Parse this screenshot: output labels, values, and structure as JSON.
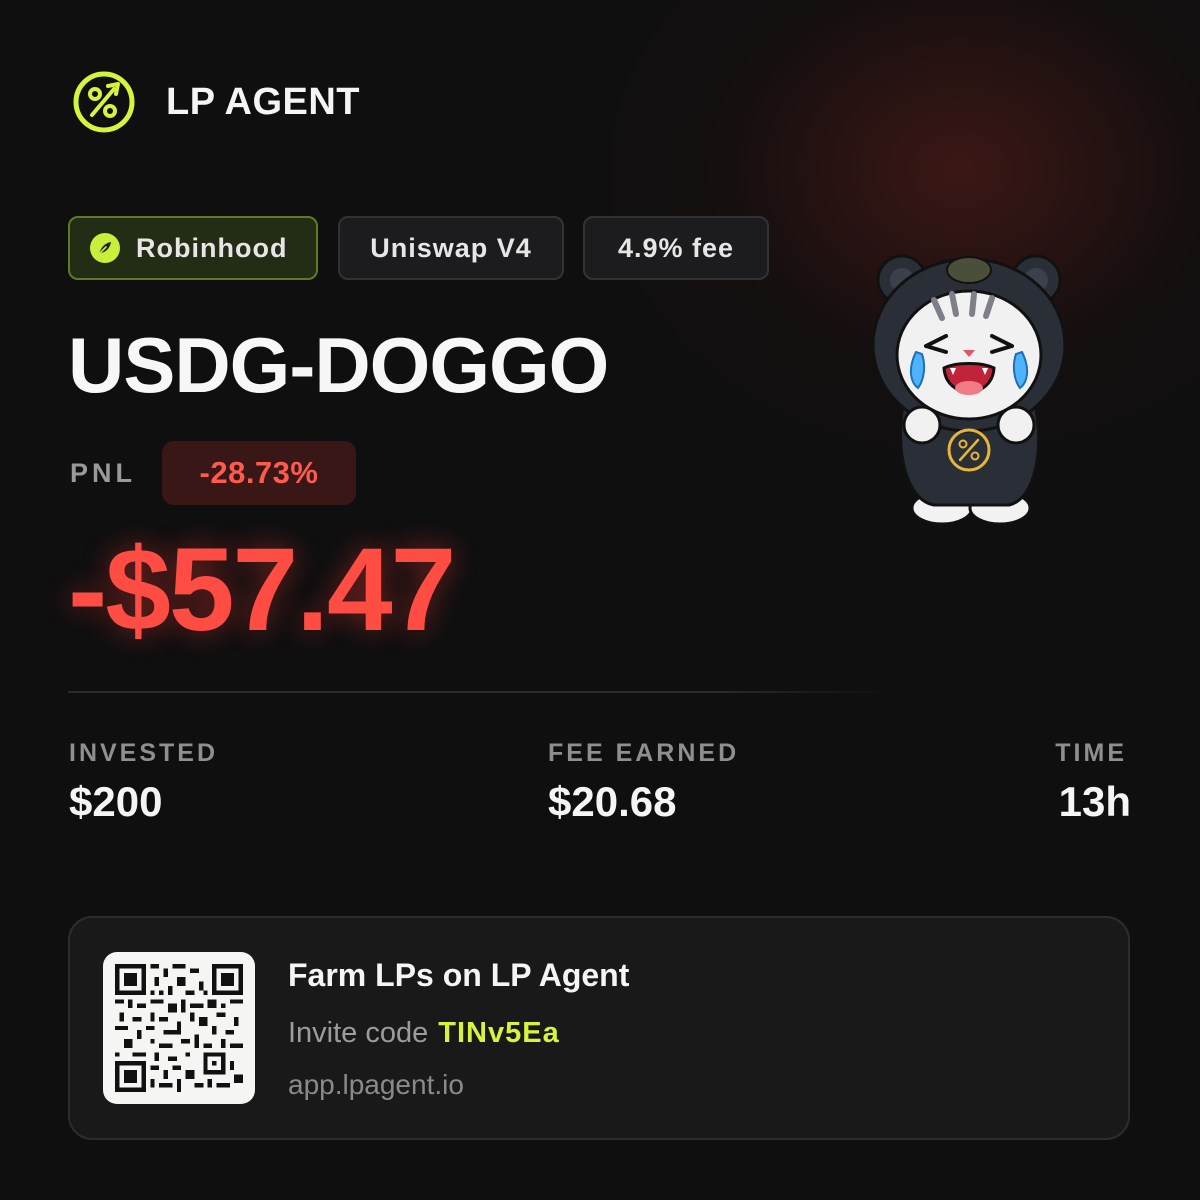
{
  "brand": {
    "name": "LP AGENT",
    "logo_icon": "percent-arrow-icon",
    "accent_color": "#d4f53c"
  },
  "tags": {
    "chain": "Robinhood",
    "chain_icon": "feather-icon",
    "dex": "Uniswap V4",
    "fee_tier": "4.9% fee"
  },
  "pair": "USDG-DOGGO",
  "pnl": {
    "label": "PNL",
    "percent": "-28.73%",
    "amount": "-$57.47",
    "color": "#ff4d43"
  },
  "stats": {
    "invested": {
      "label": "INVESTED",
      "value": "$200"
    },
    "fee_earned": {
      "label": "FEE EARNED",
      "value": "$20.68"
    },
    "time": {
      "label": "TIME",
      "value": "13h"
    }
  },
  "invite": {
    "title": "Farm LPs on LP Agent",
    "code_label": "Invite code",
    "code": "TINv5Ea",
    "url": "app.lpagent.io",
    "qr_icon": "qr-code-icon"
  },
  "mascot": {
    "icon": "crying-cat-mascot-icon"
  }
}
